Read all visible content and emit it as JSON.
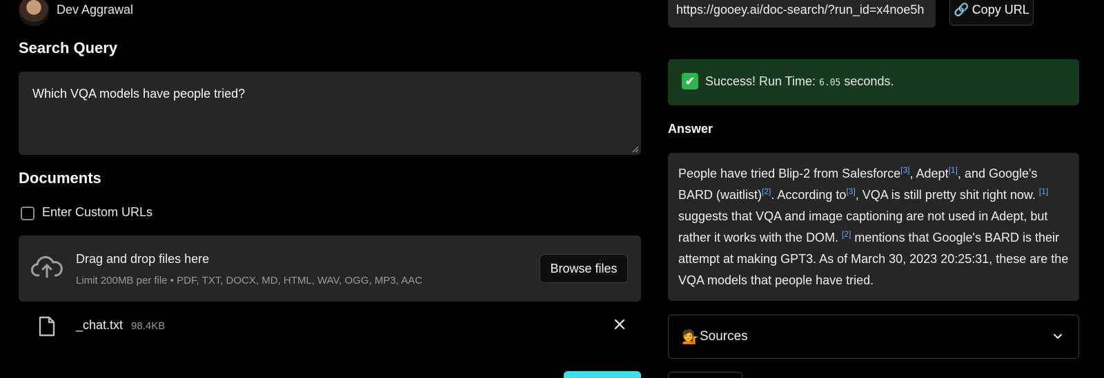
{
  "author": {
    "name": "Dev Aggrawal"
  },
  "search": {
    "heading": "Search Query",
    "query": "Which VQA models have people tried?"
  },
  "documents": {
    "heading": "Documents",
    "custom_urls_label": "Enter Custom URLs",
    "dropzone_title": "Drag and drop files here",
    "dropzone_limit": "Limit 200MB per file • PDF, TXT, DOCX, MD, HTML, WAV, OGG, MP3, AAC",
    "browse_label": "Browse files",
    "file": {
      "name": "_chat.txt",
      "size": "98.4KB"
    }
  },
  "share": {
    "url": "https://gooey.ai/doc-search/?run_id=x4noe5h",
    "copy_label": "Copy URL",
    "copy_icon": "🔗"
  },
  "status": {
    "icon": "✔",
    "prefix": "Success! Run Time:",
    "time": "6.05",
    "suffix": "seconds."
  },
  "answer": {
    "heading": "Answer",
    "segments": [
      {
        "t": "People have tried Blip-2 from Salesforce"
      },
      {
        "ref": "[3]"
      },
      {
        "t": ", Adept"
      },
      {
        "ref": "[1]"
      },
      {
        "t": ", and Google's BARD (waitlist)"
      },
      {
        "ref": "[2]"
      },
      {
        "t": ". According to"
      },
      {
        "ref": "[3]"
      },
      {
        "t": ", VQA is still pretty shit right now. "
      },
      {
        "ref": "[1]"
      },
      {
        "t": " suggests that VQA and image captioning are not used in Adept, but rather it works with the DOM. "
      },
      {
        "ref": "[2]"
      },
      {
        "t": " mentions that Google's BARD is their attempt at making GPT3. As of March 30, 2023 20:25:31, these are the VQA models that people have tried."
      }
    ]
  },
  "sources": {
    "emoji": "💁",
    "label": "Sources"
  },
  "colors": {
    "accent": "#3de0e8",
    "success_bg": "#173a1e",
    "ref_link": "#6aa8ff"
  }
}
